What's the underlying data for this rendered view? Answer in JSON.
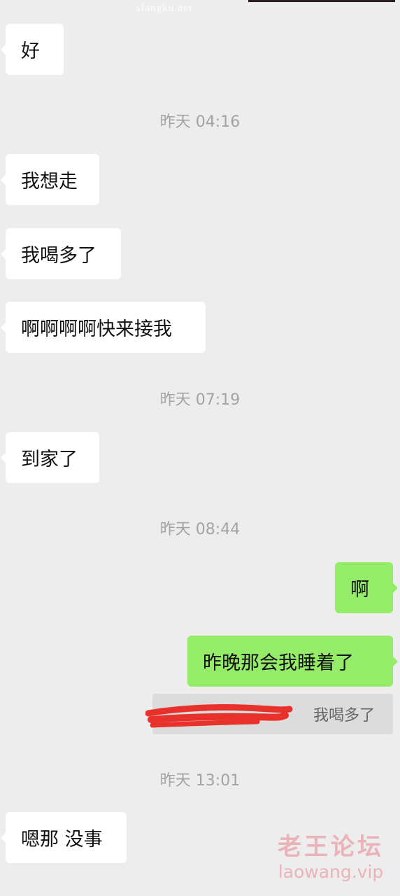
{
  "watermark_top": "sfangku.net",
  "messages": [
    {
      "text": "好"
    },
    {
      "text": "我想走"
    },
    {
      "text": "我喝多了"
    },
    {
      "text": "啊啊啊啊快来接我"
    },
    {
      "text": "到家了"
    },
    {
      "text": "啊"
    },
    {
      "text": "昨晚那会我睡着了"
    },
    {
      "text": "嗯那 没事"
    }
  ],
  "timestamps": [
    "昨天 04:16",
    "昨天 07:19",
    "昨天 08:44",
    "昨天 13:01"
  ],
  "quote": {
    "text": "我喝多了"
  },
  "forum_logo": {
    "cn": "老王论坛",
    "en": "laowang.vip"
  },
  "colors": {
    "background": "#ededed",
    "incoming_bubble": "#ffffff",
    "outgoing_bubble": "#95ec69",
    "timestamp_text": "#a3a3a3",
    "redaction": "#e8312a"
  }
}
